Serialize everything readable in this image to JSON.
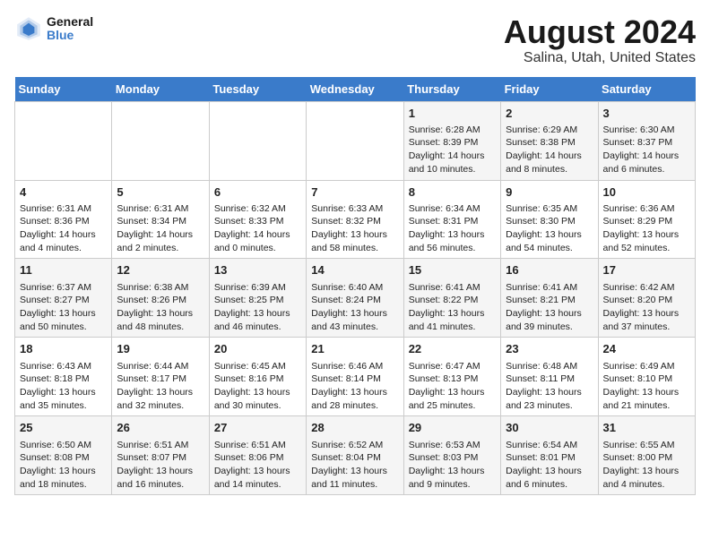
{
  "logo": {
    "line1": "General",
    "line2": "Blue"
  },
  "title": "August 2024",
  "subtitle": "Salina, Utah, United States",
  "days_of_week": [
    "Sunday",
    "Monday",
    "Tuesday",
    "Wednesday",
    "Thursday",
    "Friday",
    "Saturday"
  ],
  "weeks": [
    [
      {
        "day": "",
        "info": ""
      },
      {
        "day": "",
        "info": ""
      },
      {
        "day": "",
        "info": ""
      },
      {
        "day": "",
        "info": ""
      },
      {
        "day": "1",
        "info": "Sunrise: 6:28 AM\nSunset: 8:39 PM\nDaylight: 14 hours and 10 minutes."
      },
      {
        "day": "2",
        "info": "Sunrise: 6:29 AM\nSunset: 8:38 PM\nDaylight: 14 hours and 8 minutes."
      },
      {
        "day": "3",
        "info": "Sunrise: 6:30 AM\nSunset: 8:37 PM\nDaylight: 14 hours and 6 minutes."
      }
    ],
    [
      {
        "day": "4",
        "info": "Sunrise: 6:31 AM\nSunset: 8:36 PM\nDaylight: 14 hours and 4 minutes."
      },
      {
        "day": "5",
        "info": "Sunrise: 6:31 AM\nSunset: 8:34 PM\nDaylight: 14 hours and 2 minutes."
      },
      {
        "day": "6",
        "info": "Sunrise: 6:32 AM\nSunset: 8:33 PM\nDaylight: 14 hours and 0 minutes."
      },
      {
        "day": "7",
        "info": "Sunrise: 6:33 AM\nSunset: 8:32 PM\nDaylight: 13 hours and 58 minutes."
      },
      {
        "day": "8",
        "info": "Sunrise: 6:34 AM\nSunset: 8:31 PM\nDaylight: 13 hours and 56 minutes."
      },
      {
        "day": "9",
        "info": "Sunrise: 6:35 AM\nSunset: 8:30 PM\nDaylight: 13 hours and 54 minutes."
      },
      {
        "day": "10",
        "info": "Sunrise: 6:36 AM\nSunset: 8:29 PM\nDaylight: 13 hours and 52 minutes."
      }
    ],
    [
      {
        "day": "11",
        "info": "Sunrise: 6:37 AM\nSunset: 8:27 PM\nDaylight: 13 hours and 50 minutes."
      },
      {
        "day": "12",
        "info": "Sunrise: 6:38 AM\nSunset: 8:26 PM\nDaylight: 13 hours and 48 minutes."
      },
      {
        "day": "13",
        "info": "Sunrise: 6:39 AM\nSunset: 8:25 PM\nDaylight: 13 hours and 46 minutes."
      },
      {
        "day": "14",
        "info": "Sunrise: 6:40 AM\nSunset: 8:24 PM\nDaylight: 13 hours and 43 minutes."
      },
      {
        "day": "15",
        "info": "Sunrise: 6:41 AM\nSunset: 8:22 PM\nDaylight: 13 hours and 41 minutes."
      },
      {
        "day": "16",
        "info": "Sunrise: 6:41 AM\nSunset: 8:21 PM\nDaylight: 13 hours and 39 minutes."
      },
      {
        "day": "17",
        "info": "Sunrise: 6:42 AM\nSunset: 8:20 PM\nDaylight: 13 hours and 37 minutes."
      }
    ],
    [
      {
        "day": "18",
        "info": "Sunrise: 6:43 AM\nSunset: 8:18 PM\nDaylight: 13 hours and 35 minutes."
      },
      {
        "day": "19",
        "info": "Sunrise: 6:44 AM\nSunset: 8:17 PM\nDaylight: 13 hours and 32 minutes."
      },
      {
        "day": "20",
        "info": "Sunrise: 6:45 AM\nSunset: 8:16 PM\nDaylight: 13 hours and 30 minutes."
      },
      {
        "day": "21",
        "info": "Sunrise: 6:46 AM\nSunset: 8:14 PM\nDaylight: 13 hours and 28 minutes."
      },
      {
        "day": "22",
        "info": "Sunrise: 6:47 AM\nSunset: 8:13 PM\nDaylight: 13 hours and 25 minutes."
      },
      {
        "day": "23",
        "info": "Sunrise: 6:48 AM\nSunset: 8:11 PM\nDaylight: 13 hours and 23 minutes."
      },
      {
        "day": "24",
        "info": "Sunrise: 6:49 AM\nSunset: 8:10 PM\nDaylight: 13 hours and 21 minutes."
      }
    ],
    [
      {
        "day": "25",
        "info": "Sunrise: 6:50 AM\nSunset: 8:08 PM\nDaylight: 13 hours and 18 minutes."
      },
      {
        "day": "26",
        "info": "Sunrise: 6:51 AM\nSunset: 8:07 PM\nDaylight: 13 hours and 16 minutes."
      },
      {
        "day": "27",
        "info": "Sunrise: 6:51 AM\nSunset: 8:06 PM\nDaylight: 13 hours and 14 minutes."
      },
      {
        "day": "28",
        "info": "Sunrise: 6:52 AM\nSunset: 8:04 PM\nDaylight: 13 hours and 11 minutes."
      },
      {
        "day": "29",
        "info": "Sunrise: 6:53 AM\nSunset: 8:03 PM\nDaylight: 13 hours and 9 minutes."
      },
      {
        "day": "30",
        "info": "Sunrise: 6:54 AM\nSunset: 8:01 PM\nDaylight: 13 hours and 6 minutes."
      },
      {
        "day": "31",
        "info": "Sunrise: 6:55 AM\nSunset: 8:00 PM\nDaylight: 13 hours and 4 minutes."
      }
    ]
  ]
}
